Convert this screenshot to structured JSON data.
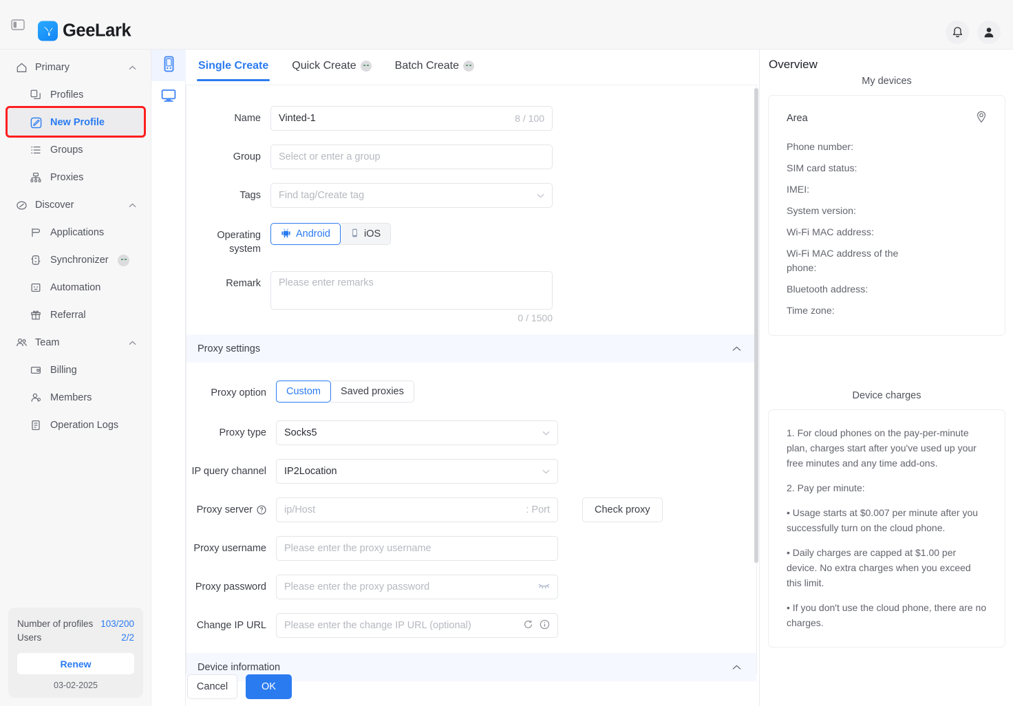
{
  "window": {
    "minimize": "minimize-icon",
    "maximize": "maximize-icon",
    "close": "close-icon"
  },
  "appbar": {
    "brand": "GeeLark",
    "collapse_icon": "sidebar-collapse-icon",
    "notification_icon": "bell-icon",
    "account_icon": "user-avatar-icon"
  },
  "sidebar": {
    "groups": [
      {
        "label": "Primary",
        "icon": "home-icon",
        "expanded": true,
        "items": [
          {
            "label": "Profiles",
            "icon": "profiles-icon",
            "active": false,
            "badge": false
          },
          {
            "label": "New Profile",
            "icon": "new-profile-icon",
            "active": true,
            "badge": false
          },
          {
            "label": "Groups",
            "icon": "groups-icon",
            "active": false,
            "badge": false
          },
          {
            "label": "Proxies",
            "icon": "proxies-icon",
            "active": false,
            "badge": false
          }
        ]
      },
      {
        "label": "Discover",
        "icon": "compass-icon",
        "expanded": true,
        "items": [
          {
            "label": "Applications",
            "icon": "applications-icon",
            "active": false,
            "badge": false
          },
          {
            "label": "Synchronizer",
            "icon": "synchronizer-icon",
            "active": false,
            "badge": true
          },
          {
            "label": "Automation",
            "icon": "automation-icon",
            "active": false,
            "badge": false
          },
          {
            "label": "Referral",
            "icon": "gift-icon",
            "active": false,
            "badge": false
          }
        ]
      },
      {
        "label": "Team",
        "icon": "team-icon",
        "expanded": true,
        "items": [
          {
            "label": "Billing",
            "icon": "billing-icon",
            "active": false,
            "badge": false
          },
          {
            "label": "Members",
            "icon": "members-icon",
            "active": false,
            "badge": false
          },
          {
            "label": "Operation Logs",
            "icon": "logs-icon",
            "active": false,
            "badge": false
          }
        ]
      }
    ],
    "footer": {
      "profiles_label": "Number of profiles",
      "profiles_value": "103/200",
      "users_label": "Users",
      "users_value": "2/2",
      "renew_label": "Renew",
      "date": "03-02-2025"
    }
  },
  "rail": {
    "items": [
      {
        "icon": "phone-icon",
        "active": true
      },
      {
        "icon": "desktop-icon",
        "active": false
      }
    ]
  },
  "main": {
    "tabs": [
      {
        "label": "Single Create",
        "active": true,
        "badge": false
      },
      {
        "label": "Quick Create",
        "active": false,
        "badge": true
      },
      {
        "label": "Batch Create",
        "active": false,
        "badge": true
      }
    ],
    "form": {
      "name": {
        "label": "Name",
        "value": "Vinted-1",
        "counter": "8 / 100"
      },
      "group": {
        "label": "Group",
        "placeholder": "Select or enter a group",
        "value": ""
      },
      "tags": {
        "label": "Tags",
        "placeholder": "Find tag/Create tag",
        "value": ""
      },
      "os": {
        "label": "Operating system",
        "options": [
          {
            "label": "Android",
            "icon": "android-icon",
            "selected": true
          },
          {
            "label": "iOS",
            "icon": "apple-device-icon",
            "selected": false
          }
        ]
      },
      "remark": {
        "label": "Remark",
        "placeholder": "Please enter remarks",
        "value": "",
        "counter": "0 / 1500"
      }
    },
    "proxy_section": {
      "title": "Proxy settings",
      "collapse_icon": "chevron-up-icon",
      "proxy_option": {
        "label": "Proxy option",
        "options": [
          {
            "label": "Custom",
            "selected": true
          },
          {
            "label": "Saved proxies",
            "selected": false
          }
        ]
      },
      "proxy_type": {
        "label": "Proxy type",
        "value": "Socks5"
      },
      "ip_query_channel": {
        "label": "IP query channel",
        "value": "IP2Location"
      },
      "proxy_server": {
        "label": "Proxy server",
        "help_icon": "question-circle-icon",
        "host_placeholder": "ip/Host",
        "port_placeholder": ": Port",
        "check_button": "Check proxy"
      },
      "proxy_username": {
        "label": "Proxy username",
        "placeholder": "Please enter the proxy username"
      },
      "proxy_password": {
        "label": "Proxy password",
        "placeholder": "Please enter the proxy password",
        "eye_icon": "eye-off-icon"
      },
      "change_ip_url": {
        "label": "Change IP URL",
        "placeholder": "Please enter the change IP URL (optional)",
        "refresh_icon": "refresh-icon",
        "info_icon": "info-circle-icon"
      }
    },
    "device_section": {
      "title": "Device information",
      "collapse_icon": "chevron-up-icon"
    },
    "footer": {
      "cancel": "Cancel",
      "ok": "OK"
    }
  },
  "right": {
    "title": "Overview",
    "devices": {
      "caption": "My devices",
      "area_label": "Area",
      "pin_icon": "location-pin-icon",
      "fields": [
        "Phone number:",
        "SIM card status:",
        "IMEI:",
        "System version:",
        "Wi-Fi MAC address:",
        "Wi-Fi MAC address of the phone:",
        "Bluetooth address:",
        "Time zone:"
      ]
    },
    "charges": {
      "caption": "Device charges",
      "paragraphs": [
        "1. For cloud phones on the pay-per-minute plan, charges start after you've used up your free minutes and any time add-ons.",
        "2. Pay per minute:",
        "• Usage starts at $0.007 per minute after you successfully turn on the cloud phone.",
        "• Daily charges are capped at $1.00 per device. No extra charges when you exceed this limit.",
        "• If you don't use the cloud phone, there are no charges."
      ]
    }
  },
  "colors": {
    "accent": "#2a7bf0",
    "sidebar_bg": "#f7f7f8",
    "section_bg": "#f5f8ff",
    "highlight": "#ff1f1f"
  }
}
